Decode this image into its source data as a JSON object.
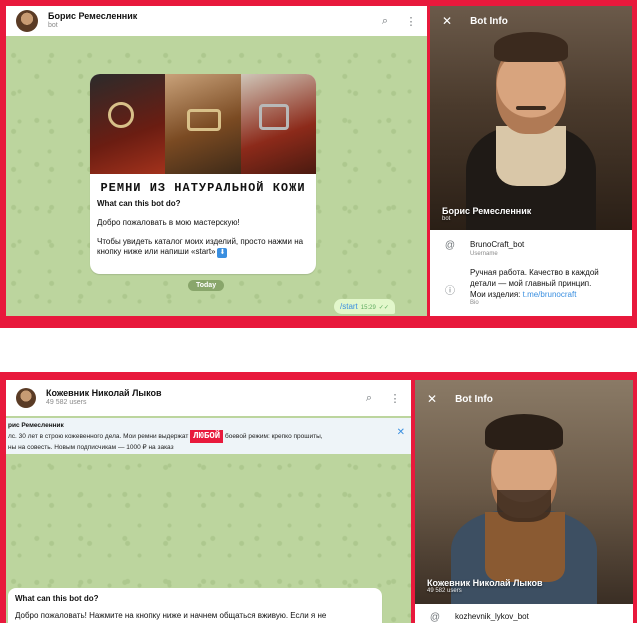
{
  "top": {
    "chat": {
      "name": "Борис Ремесленник",
      "status": "bot",
      "message": {
        "banner": "РЕМНИ ИЗ НАТУРАЛЬНОЙ КОЖИ",
        "heading": "What can this bot do?",
        "line1": "Добро пожаловать в мою мастерскую!",
        "line2": "Чтобы увидеть каталог моих изделий, просто нажми на кнопку ниже или напиши «start»"
      },
      "date_pill": "Today",
      "sent": {
        "text": "/start",
        "time": "15:29"
      }
    },
    "info": {
      "title": "Bot Info",
      "name": "Борис Ремесленник",
      "name_sub": "bot",
      "username": "BrunoCraft_bot",
      "username_caption": "Username",
      "bio_lines": [
        "Ручная работа. Качество в каждой",
        "детали — мой главный принцип.",
        "Мои изделия: "
      ],
      "bio_link": "t.me/brunocraft",
      "bio_caption": "Bio"
    }
  },
  "bottom": {
    "chat": {
      "name": "Кожевник Николай Лыков",
      "status": "49 582 users",
      "pinned": {
        "author": "рис Ремесленник",
        "text_pre": "лс. 30 лет в строю кожевенного дела. Мои ремни выдержат",
        "badge": "ЛЮБОЙ",
        "text_post": "боевой режим: крепко прошиты,",
        "line2": "ны на совесть. Новым подписчикам — 1000 ₽ на заказ"
      },
      "message": {
        "heading": "What can this bot do?",
        "line1": "Добро пожаловать! Нажмите на кнопку ниже и начнем общаться вживую. Если я не"
      }
    },
    "info": {
      "title": "Bot Info",
      "name": "Кожевник Николай Лыков",
      "name_sub": "49 582 users",
      "username": "kozhevnik_lykov_bot"
    }
  },
  "icons": {
    "search": "search-icon",
    "menu": "more-vertical-icon",
    "close": "close-icon",
    "username": "at-icon",
    "bio": "info-icon"
  },
  "colors": {
    "frame": "#e8193c",
    "chat_bg": "#bcd59e",
    "link": "#3a8fe0"
  }
}
